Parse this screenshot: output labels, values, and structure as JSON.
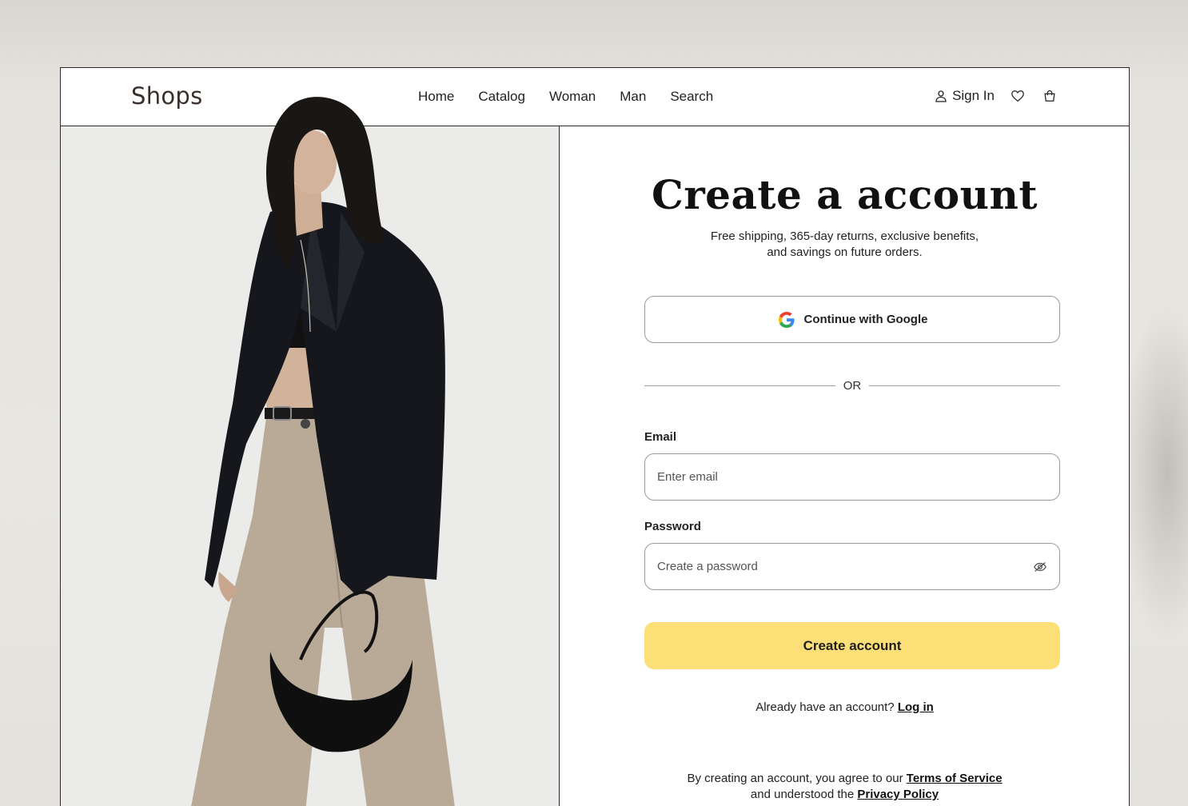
{
  "header": {
    "logo": "Shops",
    "nav": [
      "Home",
      "Catalog",
      "Woman",
      "Man",
      "Search"
    ],
    "sign_in": "Sign In"
  },
  "form": {
    "title": "Create a  account",
    "subtitle_line1": "Free shipping, 365-day returns, exclusive benefits,",
    "subtitle_line2": "and savings on future orders.",
    "google_label": "Continue with Google",
    "or": "OR",
    "email_label": "Email",
    "email_placeholder": "Enter email",
    "password_label": "Password",
    "password_placeholder": "Create a password",
    "submit_label": "Create account",
    "have_account": "Already have an account?",
    "login_link": "Log in",
    "terms_prefix": "By creating an account, you agree to our",
    "terms_link": "Terms of Service",
    "privacy_prefix": "and understood the",
    "privacy_link": "Privacy Policy"
  },
  "colors": {
    "accent": "#fddf77",
    "border": "#2a2a2a",
    "panel_bg": "#ebebe9"
  },
  "icons": [
    "user-icon",
    "heart-icon",
    "shopping-bag-icon",
    "google-icon",
    "eye-off-icon"
  ]
}
